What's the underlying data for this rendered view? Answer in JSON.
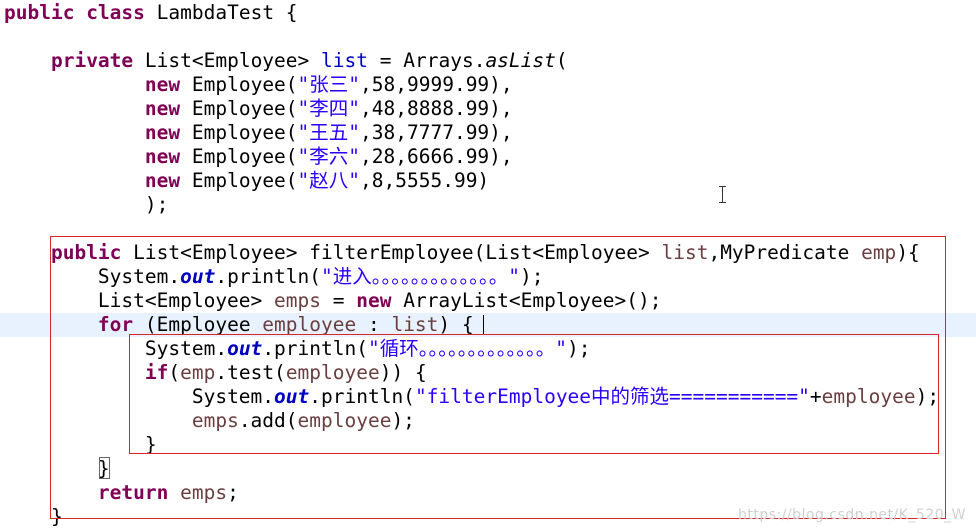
{
  "code": {
    "l1": {
      "kw1": "public",
      "kw2": "class",
      "rest": "LambdaTest {"
    },
    "l3": {
      "kw": "private",
      "type": "List<Employee>",
      "field": "list",
      "eq": "=",
      "cls": "Arrays.",
      "meth": "asList",
      "paren": "("
    },
    "emp_rows": [
      {
        "kw": "new",
        "pre": "Employee(",
        "str": "\"张三\"",
        "post": ",58,9999.99),"
      },
      {
        "kw": "new",
        "pre": "Employee(",
        "str": "\"李四\"",
        "post": ",48,8888.99),"
      },
      {
        "kw": "new",
        "pre": "Employee(",
        "str": "\"王五\"",
        "post": ",38,7777.99),"
      },
      {
        "kw": "new",
        "pre": "Employee(",
        "str": "\"李六\"",
        "post": ",28,6666.99),"
      },
      {
        "kw": "new",
        "pre": "Employee(",
        "str": "\"赵八\"",
        "post": ",8,5555.99)"
      }
    ],
    "l9": ");",
    "l11": {
      "kw": "public",
      "a": "List<Employee> filterEmployee(List<Employee> ",
      "p1": "list",
      "b": ",MyPredicate ",
      "p2": "emp",
      "c": "){"
    },
    "l12": {
      "a": "System.",
      "out": "out",
      "b": ".println(",
      "str": "\"进入。。。。。。。。。。。。。\"",
      "c": ");"
    },
    "l13": {
      "a": "List<Employee> ",
      "v": "emps",
      "b": " = ",
      "kw": "new",
      "c": " ArrayList<Employee>();"
    },
    "l14": {
      "kw": "for",
      "a": " (Employee ",
      "v": "employee",
      "b": " : ",
      "v2": "list",
      "c": ") {"
    },
    "l15": {
      "a": "System.",
      "out": "out",
      "b": ".println(",
      "str": "\"循环。。。。。。。。。。。。。\"",
      "c": ");"
    },
    "l16": {
      "kw": "if",
      "a": "(",
      "v": "emp",
      "b": ".test(",
      "v2": "employee",
      "c": ")) {"
    },
    "l17": {
      "a": "System.",
      "out": "out",
      "b": ".println(",
      "str": "\"filterEmployee中的筛选===========\"",
      "c": "+",
      "v": "employee",
      "d": ");"
    },
    "l18": {
      "v": "emps",
      "a": ".add(",
      "v2": "employee",
      "b": ");"
    },
    "l19": "}",
    "l20": "}",
    "l21": {
      "kw": "return",
      "v": "emps",
      "a": ";"
    },
    "l22": "}"
  },
  "watermark": "https://blog.csdn.net/K_520_W"
}
